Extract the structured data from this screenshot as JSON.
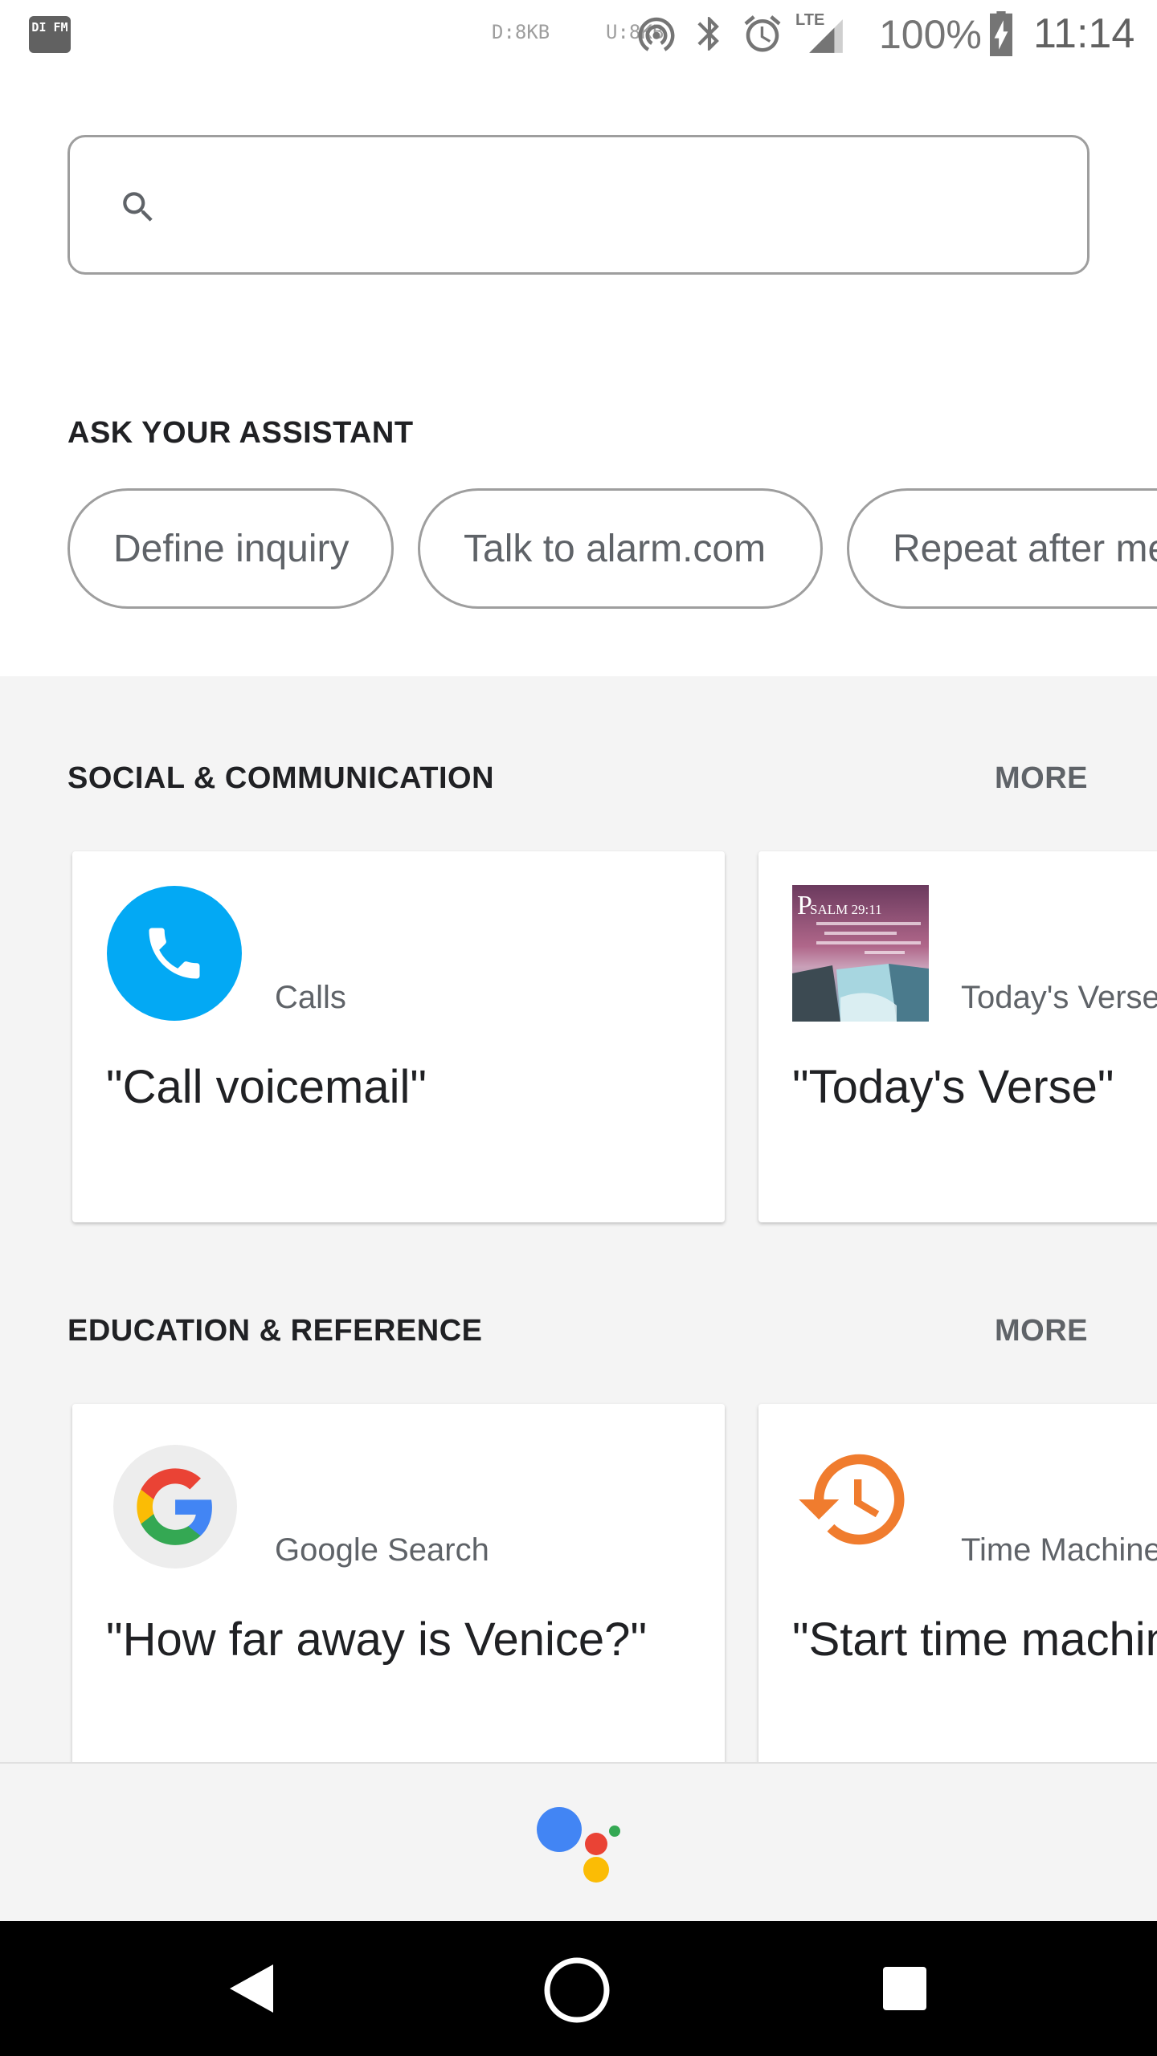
{
  "status_bar": {
    "app_icon_text": "DI FM",
    "download_speed": "D:8KB",
    "upload_speed": "U:8KB",
    "lte_label": "LTE",
    "battery_percent": "100%",
    "time": "11:14"
  },
  "search": {
    "placeholder": "",
    "value": ""
  },
  "ask_section": {
    "title": "ASK YOUR ASSISTANT",
    "chips": [
      {
        "label": "Define inquiry"
      },
      {
        "label": "Talk to alarm.com"
      },
      {
        "label": "Repeat after me"
      }
    ]
  },
  "sections": [
    {
      "title": "SOCIAL & COMMUNICATION",
      "more_label": "MORE",
      "cards": [
        {
          "app": "Calls",
          "phrase": "\"Call voicemail\"",
          "icon": "phone-icon"
        },
        {
          "app": "Today's Verse",
          "phrase": "\"Today's Verse\"",
          "icon": "psalm-thumbnail",
          "thumb_title": "Psalm 29:11",
          "thumb_text": "The Lord gives strength to His people; the Lord blesses His people with peace"
        }
      ]
    },
    {
      "title": "EDUCATION & REFERENCE",
      "more_label": "MORE",
      "cards": [
        {
          "app": "Google Search",
          "phrase": "\"How far away is Venice?\"",
          "icon": "google-g-icon"
        },
        {
          "app": "Time Machine",
          "phrase": "\"Start time machine\"",
          "icon": "history-clock-icon"
        }
      ]
    }
  ],
  "colors": {
    "calls_blue": "#03a9f4",
    "time_machine_orange": "#f07c2e",
    "assistant_blue": "#4285f4",
    "assistant_red": "#ea4335",
    "assistant_yellow": "#fbbc05",
    "assistant_green": "#34a853"
  },
  "nav_bar": {
    "back": "back-icon",
    "home": "home-icon",
    "recents": "recents-icon"
  }
}
